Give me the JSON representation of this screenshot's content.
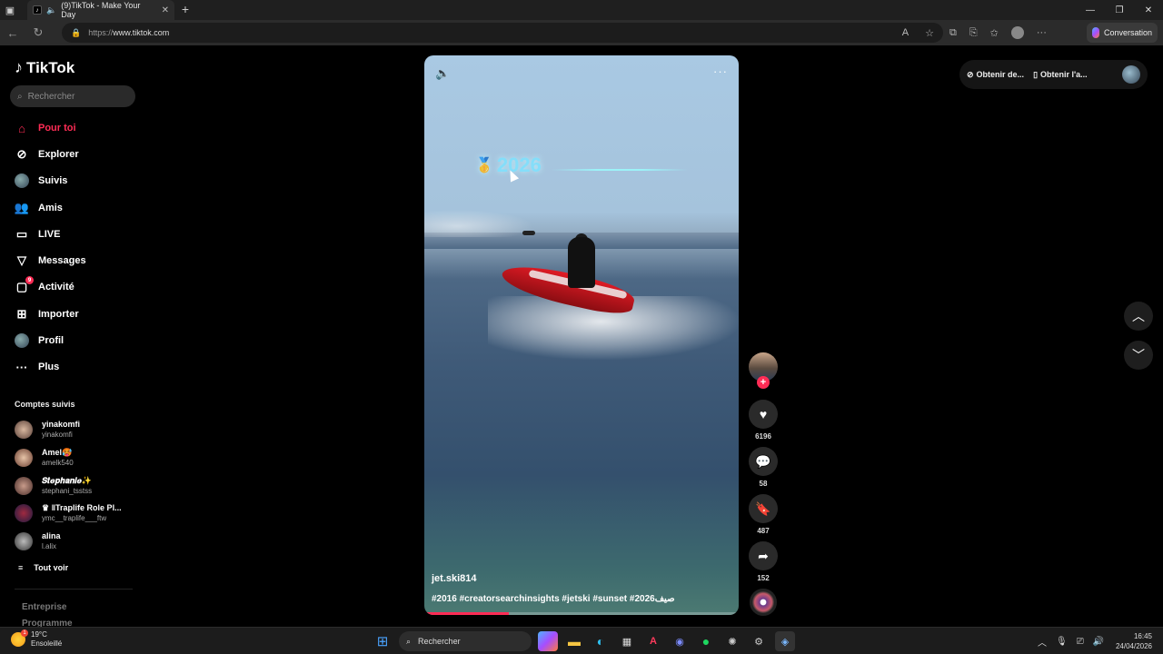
{
  "browser": {
    "tab_title": "(9)TikTok - Make Your Day",
    "url_protocol": "https://",
    "url_host": "www.tiktok.com",
    "copilot_label": "Conversation"
  },
  "sidebar": {
    "logo": "TikTok",
    "search_placeholder": "Rechercher",
    "nav": [
      {
        "label": "Pour toi",
        "icon": "home-icon"
      },
      {
        "label": "Explorer",
        "icon": "compass-icon"
      },
      {
        "label": "Suivis",
        "icon": "following-avatar-icon"
      },
      {
        "label": "Amis",
        "icon": "friends-icon"
      },
      {
        "label": "LIVE",
        "icon": "live-tv-icon"
      },
      {
        "label": "Messages",
        "icon": "send-icon"
      },
      {
        "label": "Activité",
        "icon": "activity-icon",
        "badge": "9"
      },
      {
        "label": "Importer",
        "icon": "upload-plus-icon"
      },
      {
        "label": "Profil",
        "icon": "profile-avatar-icon"
      },
      {
        "label": "Plus",
        "icon": "more-dots-icon"
      }
    ],
    "following_title": "Comptes suivis",
    "accounts": [
      {
        "name": "yinakomfi",
        "handle": "yinakomfi"
      },
      {
        "name": "Amel🥵",
        "handle": "amelk540"
      },
      {
        "name": "𝑺𝒕𝒆𝒑𝒉𝒂𝒏𝒊𝒆✨",
        "handle": "stephani_tsstss"
      },
      {
        "name": "♛ ‖Traplife Role Pl...",
        "handle": "ymc__traplife___ftw"
      },
      {
        "name": "alina",
        "handle": "l.alix"
      }
    ],
    "see_all": "Tout voir",
    "footer_1": "Entreprise",
    "footer_2": "Programme"
  },
  "video": {
    "overlay_year": "2026",
    "username": "jet.ski814",
    "description": "#2016 #creatorsearchinsights #jetski #sunset #2026صيف",
    "progress": 0.27
  },
  "actions": {
    "likes": "6196",
    "comments": "58",
    "saves": "487",
    "shares": "152"
  },
  "topright": {
    "get_coins": "Obtenir de...",
    "get_app": "Obtenir l'a..."
  },
  "taskbar": {
    "temp": "19°C",
    "weather": "Ensoleillé",
    "weather_badge": "1",
    "search": "Rechercher",
    "time": "16:45",
    "date": "24/04/2026"
  }
}
